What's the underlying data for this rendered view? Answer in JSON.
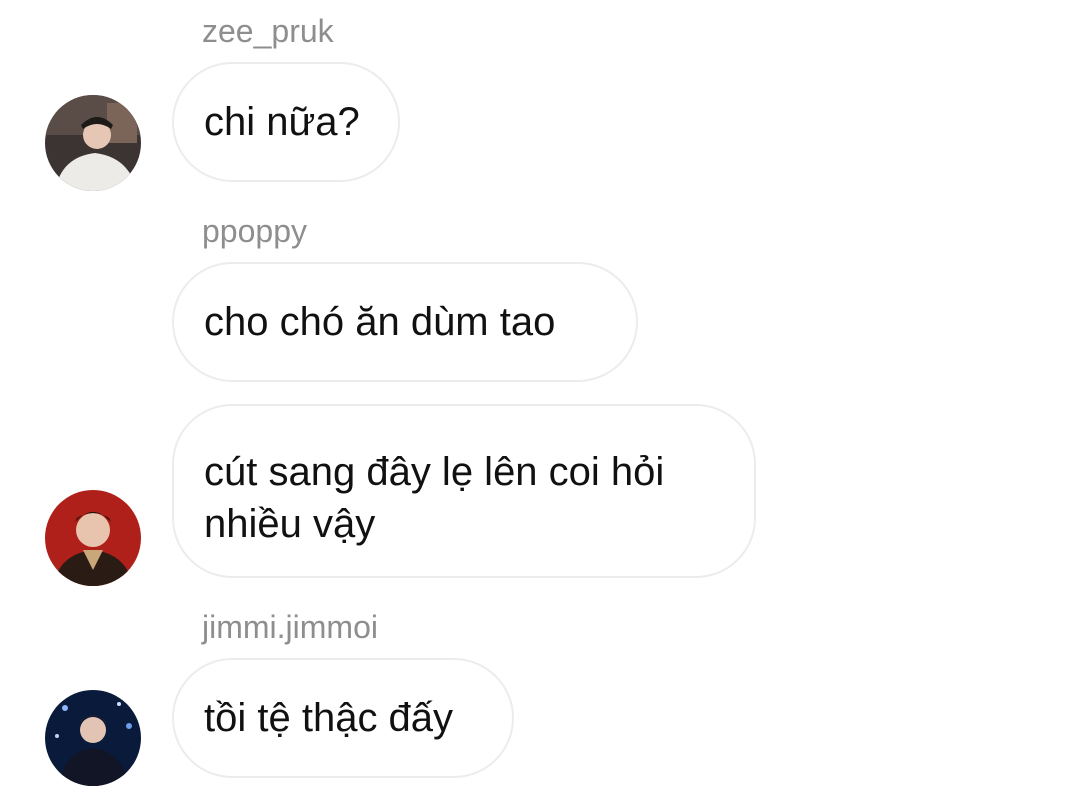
{
  "messages": [
    {
      "sender": "zee_pruk",
      "text": "chi nữa?",
      "avatar_icon": "user-avatar-1"
    },
    {
      "sender": "ppoppy",
      "text": "cho chó ăn dùm tao",
      "avatar_icon": ""
    },
    {
      "sender": "",
      "text": "cút sang đây lẹ lên coi hỏi nhiều vậy",
      "avatar_icon": "user-avatar-2"
    },
    {
      "sender": "jimmi.jimmoi",
      "text": "tồi tệ thậc đấy",
      "avatar_icon": "user-avatar-3"
    }
  ],
  "colors": {
    "bubble_border": "#ececec",
    "sender_text": "#8e8e8e",
    "message_text": "#111111",
    "avatar2_bg": "#b0201a",
    "avatar3_bg": "#0a1a3a"
  }
}
